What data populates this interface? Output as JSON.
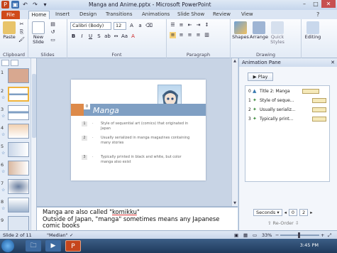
{
  "window": {
    "title": "Manga and Anime.pptx - Microsoft PowerPoint",
    "controls": [
      "–",
      "□",
      "✕"
    ]
  },
  "ribbon": {
    "tabs": [
      "File",
      "Home",
      "Insert",
      "Design",
      "Transitions",
      "Animations",
      "Slide Show",
      "Review",
      "View"
    ],
    "groups": [
      "Clipboard",
      "Slides",
      "Font",
      "Paragraph",
      "Drawing"
    ],
    "paste_label": "Paste",
    "new_slide_label": "New Slide",
    "font_name": "Calibri (Body)",
    "font_size": "12",
    "shapes_label": "Shapes",
    "arrange_label": "Arrange",
    "quick_styles_label": "Quick Styles",
    "editing_label": "Editing"
  },
  "thumbnails": {
    "numbers": [
      "1",
      "2",
      "3",
      "4",
      "5",
      "6",
      "7",
      "8",
      "9"
    ],
    "selected": "2"
  },
  "slide": {
    "number_box": "0",
    "title": "Manga",
    "bullets": [
      {
        "num": "1",
        "text": "Style of sequential art (comics) that originated in Japan"
      },
      {
        "num": "2",
        "text": "Usually serialized in manga magazines containing many stories"
      },
      {
        "num": "3",
        "text": "Typically printed in black and white, but color manga also exist"
      }
    ]
  },
  "notes": {
    "line1_prefix": "Manga are also called \"",
    "line1_word": "komikku",
    "line1_suffix": "\"",
    "line2": "Outside of Japan, \"manga\" sometimes means any Japanese comic books"
  },
  "animation_pane": {
    "title": "Animation Pane",
    "play_label": "Play",
    "items": [
      {
        "num": "0",
        "label": "Title 2: Manga"
      },
      {
        "num": "1",
        "label": "Style of seque..."
      },
      {
        "num": "2",
        "label": "Usually serializ..."
      },
      {
        "num": "3",
        "label": "Typically print..."
      }
    ],
    "seconds_label": "Seconds ▾",
    "seconds_from": "0",
    "seconds_to": "2",
    "reorder_label": "Re-Order"
  },
  "status": {
    "slide_info": "Slide 2 of 11",
    "theme": "\"Median\"",
    "zoom": "33%"
  },
  "taskbar": {
    "time": "3:45 PM"
  }
}
